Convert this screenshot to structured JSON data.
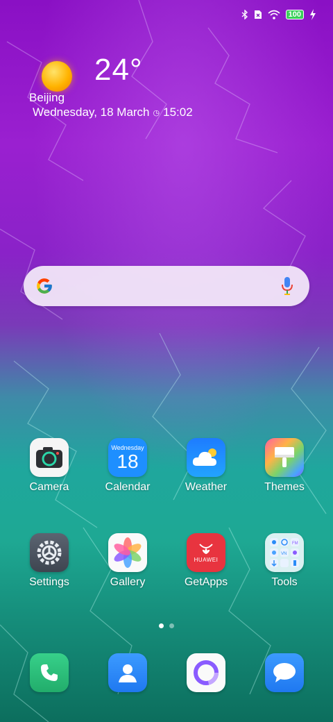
{
  "status_bar": {
    "icons": [
      "bluetooth-icon",
      "no-sim-icon",
      "wifi-icon",
      "battery-icon",
      "charging-icon"
    ],
    "battery_level": "100"
  },
  "weather": {
    "temperature": "24°",
    "city": "Beijing",
    "date": "Wednesday, 18 March",
    "alarm_icon": "◷",
    "time": "15:02"
  },
  "search": {
    "logo": "google-icon",
    "mic": "microphone-icon"
  },
  "apps_row1": [
    {
      "label": "Camera",
      "icon": "camera-icon"
    },
    {
      "label": "Calendar",
      "icon": "calendar-icon",
      "day_name": "Wednesday",
      "day_number": "18"
    },
    {
      "label": "Weather",
      "icon": "weather-icon"
    },
    {
      "label": "Themes",
      "icon": "themes-icon"
    }
  ],
  "apps_row2": [
    {
      "label": "Settings",
      "icon": "settings-icon"
    },
    {
      "label": "Gallery",
      "icon": "gallery-icon"
    },
    {
      "label": "GetApps",
      "icon": "getapps-icon",
      "brand_text": "HUAWEI"
    },
    {
      "label": "Tools",
      "icon": "tools-folder-icon"
    }
  ],
  "page_indicator": {
    "pages": 2,
    "current": 1
  },
  "dock": [
    {
      "icon": "phone-icon"
    },
    {
      "icon": "contacts-icon"
    },
    {
      "icon": "browser-icon"
    },
    {
      "icon": "messages-icon"
    }
  ],
  "colors": {
    "camera_bg": "#f5f5f5",
    "calendar_bg": "#1e8fff",
    "weather_bg": "#1e90ff",
    "getapps_bg": "#e8343f",
    "phone_bg": "#2ec27e",
    "contacts_bg": "#2a8cf7",
    "messages_bg": "#2a8cf7"
  }
}
